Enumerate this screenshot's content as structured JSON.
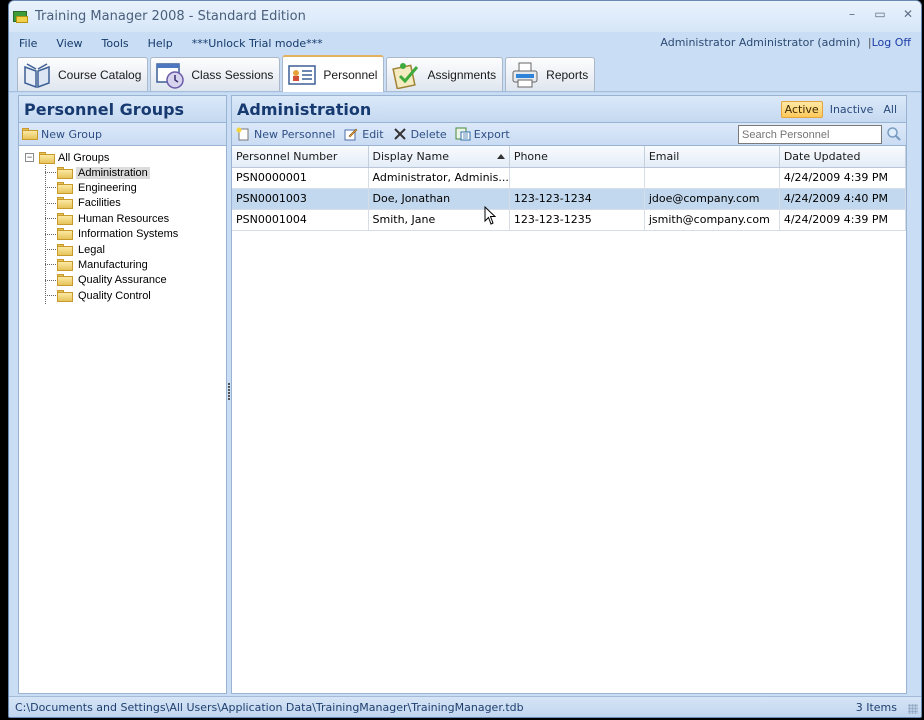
{
  "window": {
    "title": "Training Manager 2008 - Standard Edition",
    "controls": {
      "minimize": "–",
      "maximize": "▭",
      "close": "✕"
    }
  },
  "menu": {
    "items": [
      "File",
      "View",
      "Tools",
      "Help",
      "***Unlock Trial mode***"
    ],
    "user": "Administrator Administrator (admin)",
    "separator": "|",
    "logoff": "Log Off"
  },
  "tabs": [
    {
      "label": "Course Catalog",
      "icon": "book-icon",
      "active": false
    },
    {
      "label": "Class Sessions",
      "icon": "clock-window-icon",
      "active": false
    },
    {
      "label": "Personnel",
      "icon": "id-card-icon",
      "active": true
    },
    {
      "label": "Assignments",
      "icon": "clipboard-check-icon",
      "active": false
    },
    {
      "label": "Reports",
      "icon": "printer-icon",
      "active": false
    }
  ],
  "left_pane": {
    "title": "Personnel Groups",
    "new_group": "New Group",
    "tree": {
      "root": "All Groups",
      "children": [
        {
          "label": "Administration",
          "selected": true
        },
        {
          "label": "Engineering"
        },
        {
          "label": "Facilities"
        },
        {
          "label": "Human Resources"
        },
        {
          "label": "Information Systems"
        },
        {
          "label": "Legal"
        },
        {
          "label": "Manufacturing"
        },
        {
          "label": "Quality Assurance"
        },
        {
          "label": "Quality Control"
        }
      ]
    }
  },
  "right_pane": {
    "title": "Administration",
    "filters": {
      "active": "Active",
      "inactive": "Inactive",
      "all": "All",
      "selected": "Active"
    },
    "toolbar": {
      "new": "New Personnel",
      "edit": "Edit",
      "delete": "Delete",
      "export": "Export"
    },
    "search_placeholder": "Search Personnel",
    "columns": [
      "Personnel Number",
      "Display Name",
      "Phone",
      "Email",
      "Date Updated"
    ],
    "sort_column": "Display Name",
    "sort_direction": "ascending",
    "rows": [
      {
        "number": "PSN0000001",
        "name": "Administrator, Adminis...",
        "phone": "",
        "email": "",
        "updated": "4/24/2009 4:39 PM",
        "selected": false
      },
      {
        "number": "PSN0001003",
        "name": "Doe, Jonathan",
        "phone": "123-123-1234",
        "email": "jdoe@company.com",
        "updated": "4/24/2009 4:40 PM",
        "selected": true
      },
      {
        "number": "PSN0001004",
        "name": "Smith, Jane",
        "phone": "123-123-1235",
        "email": "jsmith@company.com",
        "updated": "4/24/2009 4:39 PM",
        "selected": false
      }
    ]
  },
  "status": {
    "path": "C:\\Documents and Settings\\All Users\\Application Data\\TrainingManager\\TrainingManager.tdb",
    "count": "3 Items"
  },
  "colors": {
    "accent": "#173a71",
    "active_tab_border": "#f2b74f",
    "selected_row": "#c2d8ee",
    "filter_active": "#ffc95a"
  }
}
